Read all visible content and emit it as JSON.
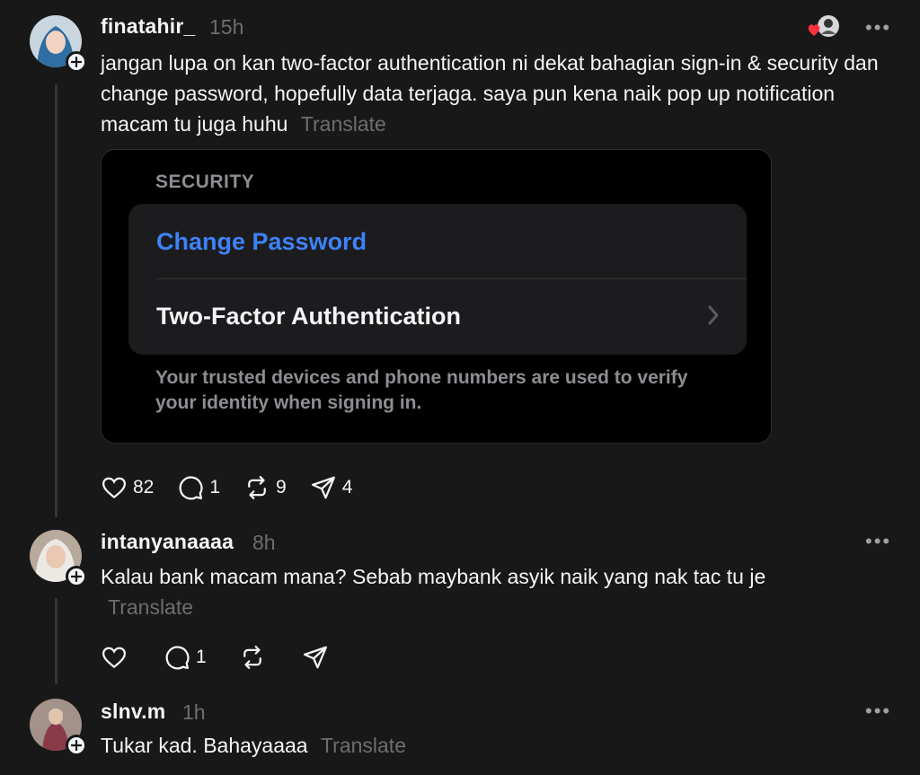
{
  "posts": [
    {
      "username": "finatahir_",
      "time": "15h",
      "text": "jangan lupa on kan two-factor authentication ni dekat bahagian sign-in & security dan change password, hopefully data terjaga. saya pun kena naik pop up notification macam tu juga huhu",
      "translate": "Translate",
      "likes": "82",
      "replies": "1",
      "reposts": "9",
      "shares": "4",
      "embed": {
        "section_header": "SECURITY",
        "row1": "Change Password",
        "row2": "Two-Factor Authentication",
        "footer": "Your trusted devices and phone numbers are used to verify your identity when signing in."
      }
    },
    {
      "username": "intanyanaaaa",
      "time": "8h",
      "text": "Kalau bank macam mana? Sebab maybank asyik naik yang nak tac tu je",
      "translate": "Translate",
      "replies": "1"
    },
    {
      "username": "slnv.m",
      "time": "1h",
      "text": "Tukar kad. Bahayaaaa",
      "translate": "Translate"
    }
  ],
  "more_label": "•••",
  "colors": {
    "background": "#181818",
    "link_blue": "#3e82f7",
    "like_red": "#ff3040",
    "muted": "#6e6e6e"
  }
}
